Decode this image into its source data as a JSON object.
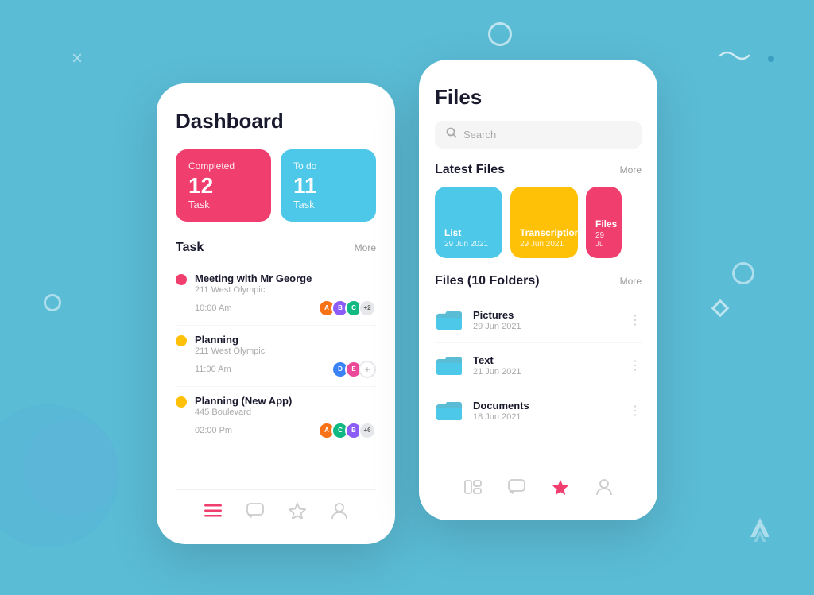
{
  "background_color": "#5bbcd6",
  "decorations": {
    "x_symbol": "×",
    "squiggle": "∿"
  },
  "dashboard": {
    "title": "Dashboard",
    "stats": {
      "completed": {
        "label": "Completed",
        "number": "12",
        "sublabel": "Task"
      },
      "todo": {
        "label": "To do",
        "number": "11",
        "sublabel": "Task"
      }
    },
    "task_section": {
      "title": "Task",
      "more_label": "More"
    },
    "tasks": [
      {
        "name": "Meeting with Mr George",
        "location": "211 West Olympic",
        "time": "10:00 Am",
        "dot_color": "pink",
        "extra_count": "+2"
      },
      {
        "name": "Planning",
        "location": "211 West Olympic",
        "time": "11:00 Am",
        "dot_color": "yellow",
        "extra_count": "+"
      },
      {
        "name": "Planning (New App)",
        "location": "445 Boulevard",
        "time": "02:00 Pm",
        "dot_color": "yellow",
        "extra_count": "+6"
      }
    ],
    "bottom_nav": [
      {
        "icon": "menu-icon",
        "active": true
      },
      {
        "icon": "chat-icon",
        "active": false
      },
      {
        "icon": "star-icon",
        "active": false
      },
      {
        "icon": "user-icon",
        "active": false
      }
    ]
  },
  "files": {
    "title": "Files",
    "search_placeholder": "Search",
    "latest_files_section": {
      "title": "Latest Files",
      "more_label": "More"
    },
    "latest_files": [
      {
        "name": "List",
        "date": "29 Jun 2021",
        "color": "blue"
      },
      {
        "name": "Transcription",
        "date": "29 Jun 2021",
        "color": "yellow"
      },
      {
        "name": "Files",
        "date": "29 Ju",
        "color": "pink"
      }
    ],
    "folders_section": {
      "title": "Files (10 Folders)",
      "more_label": "More"
    },
    "folders": [
      {
        "name": "Pictures",
        "date": "29 Jun 2021"
      },
      {
        "name": "Text",
        "date": "21 Jun 2021"
      },
      {
        "name": "Documents",
        "date": "18 Jun 2021"
      }
    ],
    "bottom_nav": [
      {
        "icon": "layout-icon",
        "active": false
      },
      {
        "icon": "chat-icon",
        "active": false
      },
      {
        "icon": "star-icon",
        "active": true
      },
      {
        "icon": "user-icon",
        "active": false
      }
    ]
  }
}
